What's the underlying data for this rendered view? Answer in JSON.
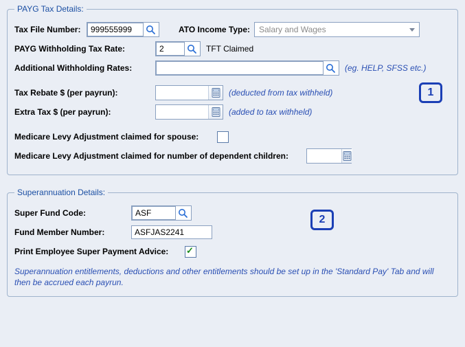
{
  "payg": {
    "legend": "PAYG Tax Details:",
    "tfn_label": "Tax File Number:",
    "tfn_value": "999555999",
    "ato_label": "ATO Income Type:",
    "ato_value": "Salary and Wages",
    "rate_label": "PAYG Withholding Tax Rate:",
    "rate_value": "2",
    "rate_suffix": "TFT Claimed",
    "addl_label": "Additional Withholding Rates:",
    "addl_value": "",
    "addl_hint": "(eg. HELP, SFSS etc.)",
    "rebate_label": "Tax Rebate $ (per payrun):",
    "rebate_value": "",
    "rebate_hint": "(deducted from tax withheld)",
    "extra_label": "Extra Tax $ (per payrun):",
    "extra_value": "",
    "extra_hint": "(added to tax withheld)",
    "med_spouse_label": "Medicare Levy Adjustment claimed for spouse:",
    "med_child_label": "Medicare Levy Adjustment claimed for number of dependent children:"
  },
  "super": {
    "legend": "Superannuation Details:",
    "fund_code_label": "Super Fund Code:",
    "fund_code_value": "ASF",
    "member_label": "Fund Member Number:",
    "member_value": "ASFJAS2241",
    "print_label": "Print Employee Super Payment Advice:",
    "info": "Superannuation entitlements, deductions and other entitlements should be set up in the 'Standard Pay' Tab and will then be accrued each payrun."
  },
  "badges": {
    "one": "1",
    "two": "2"
  }
}
